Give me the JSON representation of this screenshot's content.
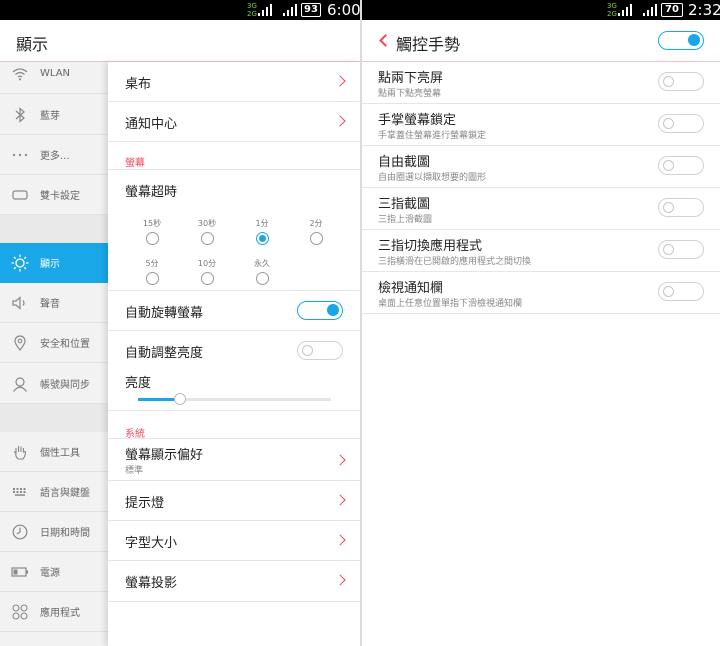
{
  "colors": {
    "accent": "#1aa7e8",
    "highlight": "#f04a5a",
    "sidebar_bg": "#f2f2f2"
  },
  "left": {
    "status": {
      "signal_top": "3G",
      "signal_bottom": "2G",
      "battery": "93",
      "time": "6:00"
    },
    "title": "顯示",
    "sidebar": [
      {
        "label": "WLAN",
        "icon": "wifi-icon"
      },
      {
        "label": "藍芽",
        "icon": "bluetooth-icon"
      },
      {
        "label": "更多...",
        "icon": "more-dots-icon"
      },
      {
        "label": "雙卡設定",
        "icon": "sim-card-icon"
      },
      {
        "label": "顯示",
        "icon": "brightness-icon",
        "active": true
      },
      {
        "label": "聲音",
        "icon": "speaker-icon"
      },
      {
        "label": "安全和位置",
        "icon": "location-pin-icon"
      },
      {
        "label": "帳號與同步",
        "icon": "person-icon"
      },
      {
        "label": "個性工具",
        "icon": "hand-icon"
      },
      {
        "label": "語言與鍵盤",
        "icon": "keyboard-icon"
      },
      {
        "label": "日期和時間",
        "icon": "clock-icon"
      },
      {
        "label": "電源",
        "icon": "battery-icon"
      },
      {
        "label": "應用程式",
        "icon": "apps-icon"
      }
    ],
    "content": {
      "wallpaper": "桌布",
      "notification_center": "通知中心",
      "section_screen": "螢幕",
      "screen_timeout": "螢幕超時",
      "timeout_options": [
        {
          "label": "15秒",
          "selected": false
        },
        {
          "label": "30秒",
          "selected": false
        },
        {
          "label": "1分",
          "selected": true
        },
        {
          "label": "2分",
          "selected": false
        },
        {
          "label": "5分",
          "selected": false
        },
        {
          "label": "10分",
          "selected": false
        },
        {
          "label": "永久",
          "selected": false
        }
      ],
      "auto_rotate": {
        "label": "自動旋轉螢幕",
        "on": true
      },
      "auto_brightness": {
        "label": "自動調整亮度",
        "on": false
      },
      "brightness": {
        "label": "亮度",
        "level": 0.22
      },
      "section_system": "系統",
      "display_pref": {
        "label": "螢幕顯示偏好",
        "sub": "標準"
      },
      "indicator_light": "提示燈",
      "font_size": "字型大小",
      "screen_cast": "螢幕投影"
    }
  },
  "right": {
    "status": {
      "signal_top": "3G",
      "signal_bottom": "2G",
      "battery": "70",
      "time": "2:32"
    },
    "title": "觸控手勢",
    "master_on": true,
    "gestures": [
      {
        "label": "點兩下亮屏",
        "sub": "點兩下點亮螢幕",
        "on": false
      },
      {
        "label": "手掌螢幕鎖定",
        "sub": "手掌蓋住螢幕進行螢幕鎖定",
        "on": false
      },
      {
        "label": "自由截圖",
        "sub": "自由圈選以擷取想要的圖形",
        "on": false
      },
      {
        "label": "三指截圖",
        "sub": "三指上滑截圖",
        "on": false
      },
      {
        "label": "三指切換應用程式",
        "sub": "三指橫滑在已開啟的應用程式之間切換",
        "on": false
      },
      {
        "label": "檢視通知欄",
        "sub": "桌面上任意位置單指下滑檢視通知欄",
        "on": false
      }
    ]
  }
}
